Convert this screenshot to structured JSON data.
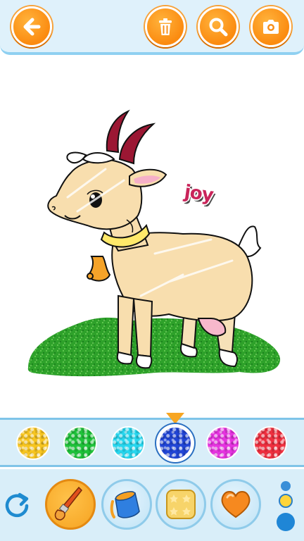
{
  "topbar": {
    "buttons": [
      {
        "name": "back",
        "icon": "arrow-left-icon"
      },
      {
        "name": "delete",
        "icon": "trash-icon"
      },
      {
        "name": "zoom",
        "icon": "magnifier-icon"
      },
      {
        "name": "screenshot",
        "icon": "camera-icon"
      }
    ],
    "accent_color": "#fb8b10"
  },
  "canvas": {
    "sticker_text": "joy",
    "subject": "goat-drawing"
  },
  "palette": {
    "colors": [
      "#f7c520",
      "#1fc23a",
      "#27d6ee",
      "#2145d6",
      "#e633e0",
      "#ef2f3f"
    ],
    "selected_index": 3
  },
  "tools": {
    "items": [
      {
        "name": "brush",
        "icon": "paintbrush-icon",
        "active": true
      },
      {
        "name": "bucket",
        "icon": "paint-bucket-icon",
        "active": false
      },
      {
        "name": "pattern",
        "icon": "star-pattern-icon",
        "active": false
      },
      {
        "name": "sticker",
        "icon": "heart-icon",
        "active": false
      }
    ],
    "redo_icon": "redo-icon",
    "size_dots": [
      "small",
      "medium",
      "large"
    ],
    "selected_size": "medium"
  }
}
